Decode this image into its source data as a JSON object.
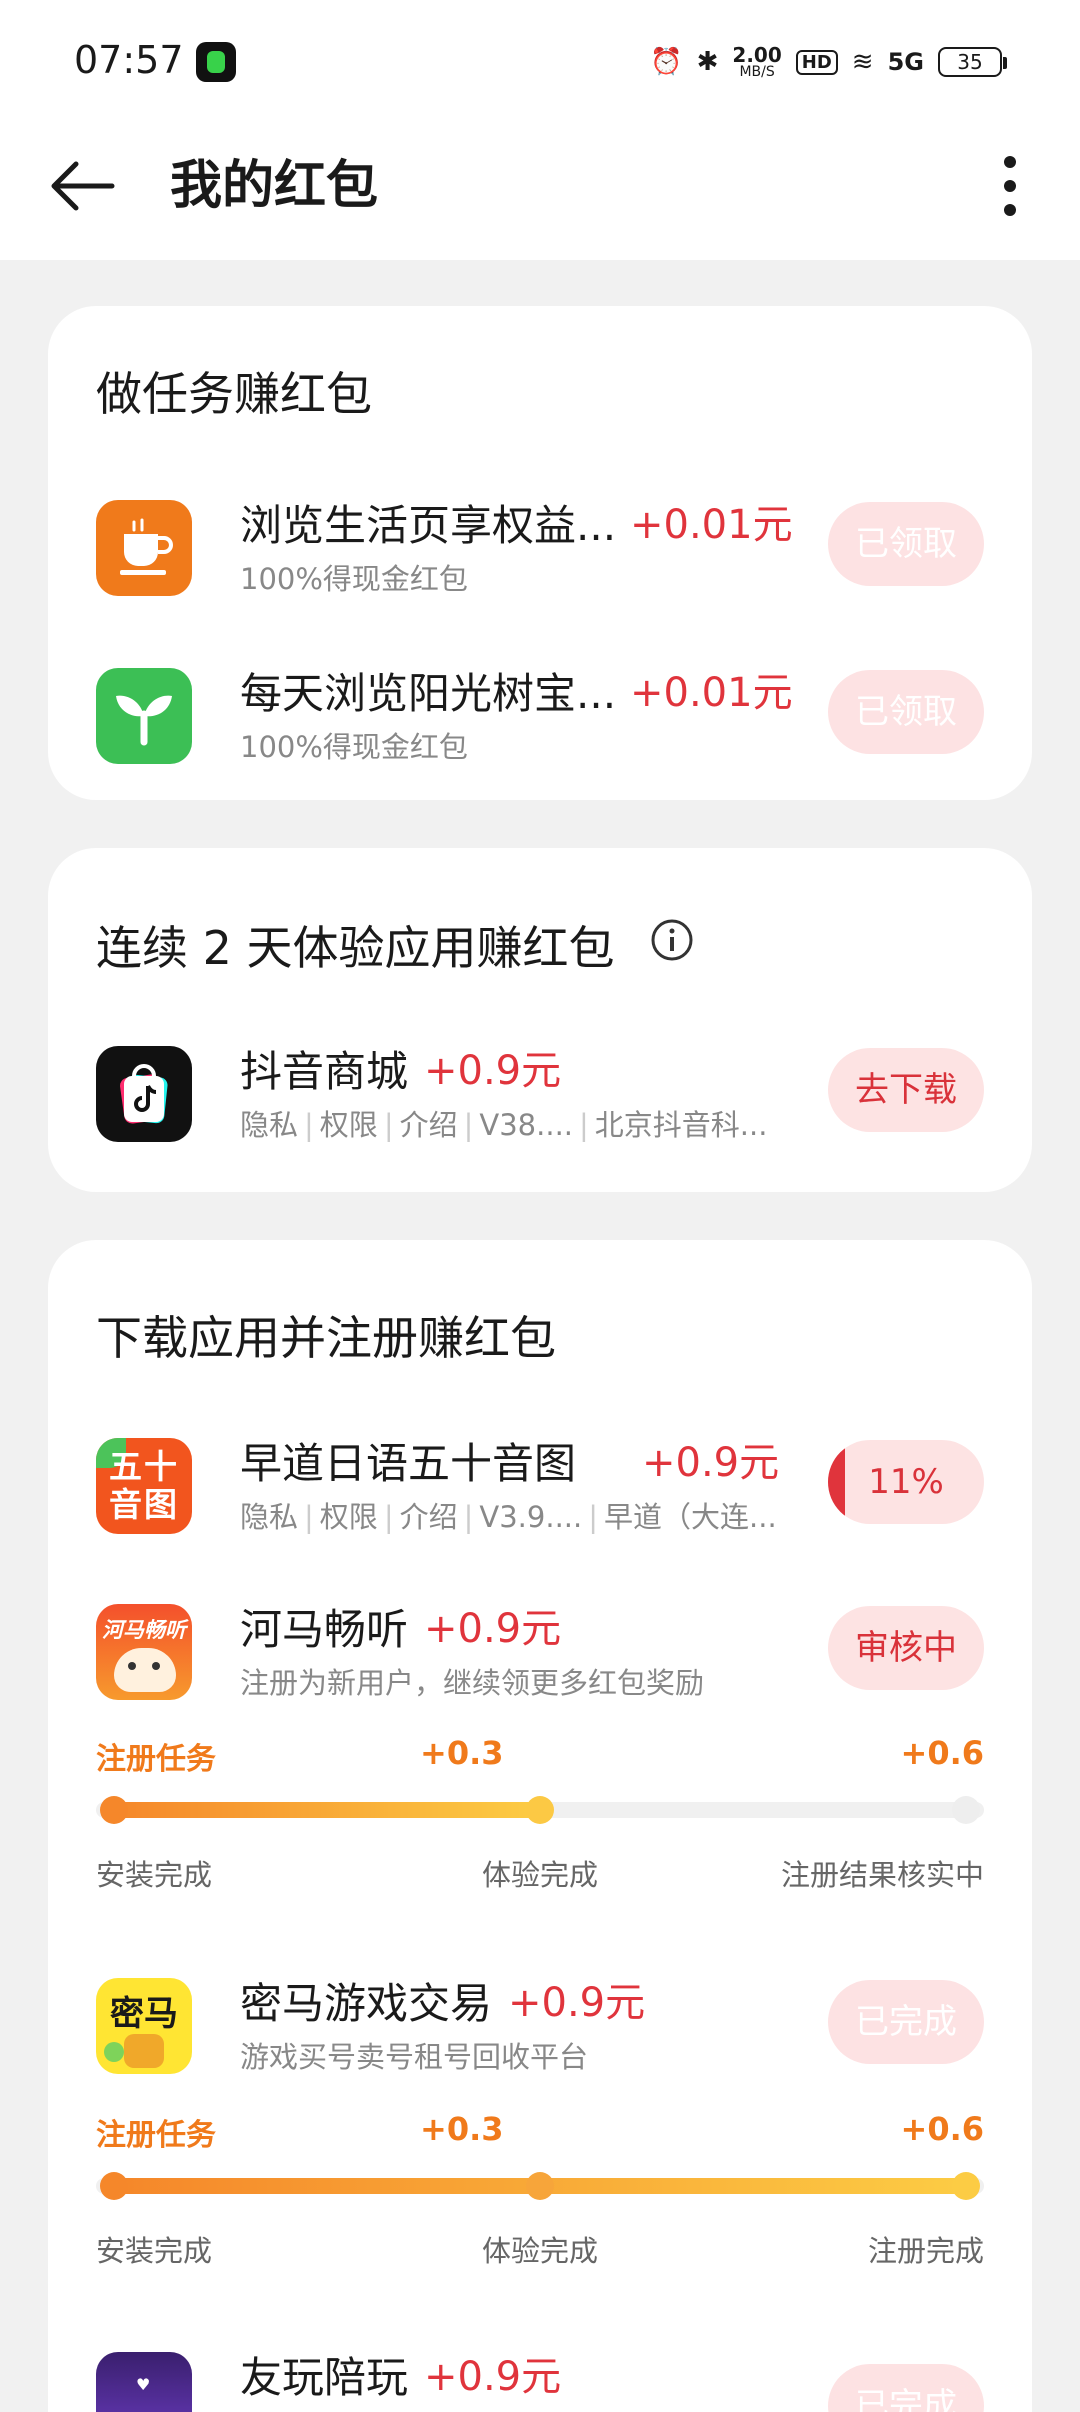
{
  "status_bar": {
    "time": "07:57",
    "speed": "2.00",
    "speed_unit": "MB/S",
    "hd": "HD",
    "network": "5G",
    "battery": "35"
  },
  "header": {
    "title": "我的红包",
    "back_icon": "back-arrow-icon",
    "more_icon": "more-vertical-icon"
  },
  "sections": {
    "tasks": {
      "title": "做任务赚红包",
      "items": [
        {
          "name": "浏览生活页享权益...",
          "reward": "+0.01元",
          "sub": "100%得现金红包",
          "button": "已领取",
          "icon": "coffee-icon",
          "color": "#f07a1b"
        },
        {
          "name": "每天浏览阳光树宝...",
          "reward": "+0.01元",
          "sub": "100%得现金红包",
          "button": "已领取",
          "icon": "sprout-icon",
          "color": "#3cbf55"
        }
      ]
    },
    "streak": {
      "title": "连续 2 天体验应用赚红包",
      "info_icon": "info-icon",
      "items": [
        {
          "name": "抖音商城",
          "reward": "+0.9元",
          "meta": [
            "隐私",
            "权限",
            "介绍",
            "V38....",
            "北京抖音科..."
          ],
          "button": "去下载",
          "icon": "douyin-mall-icon"
        }
      ]
    },
    "download": {
      "title": "下载应用并注册赚红包",
      "items": [
        {
          "name": "早道日语五十音图",
          "reward": "+0.9元",
          "meta": [
            "隐私",
            "权限",
            "介绍",
            "V3.9....",
            "早道（大连..."
          ],
          "button": "11%",
          "progress": 0.11,
          "icon": "wushiyin-icon",
          "icon_text": "五十音图"
        },
        {
          "name": "河马畅听",
          "reward": "+0.9元",
          "sub": "注册为新用户，继续领更多红包奖励",
          "button": "审核中",
          "icon": "hema-icon",
          "icon_text": "河马畅听",
          "task": {
            "label": "注册任务",
            "mid": "+0.3",
            "end": "+0.6",
            "steps": [
              "安装完成",
              "体验完成",
              "注册结果核实中"
            ],
            "progress": 0.5
          }
        },
        {
          "name": "密马游戏交易",
          "reward": "+0.9元",
          "sub": "游戏买号卖号租号回收平台",
          "button": "已完成",
          "icon": "mima-icon",
          "icon_text": "密马",
          "task": {
            "label": "注册任务",
            "mid": "+0.3",
            "end": "+0.6",
            "steps": [
              "安装完成",
              "体验完成",
              "注册完成"
            ],
            "progress": 1.0
          }
        },
        {
          "name": "友玩陪玩",
          "reward": "+0.9元",
          "button": "已完成",
          "icon": "youwan-icon"
        }
      ]
    }
  }
}
